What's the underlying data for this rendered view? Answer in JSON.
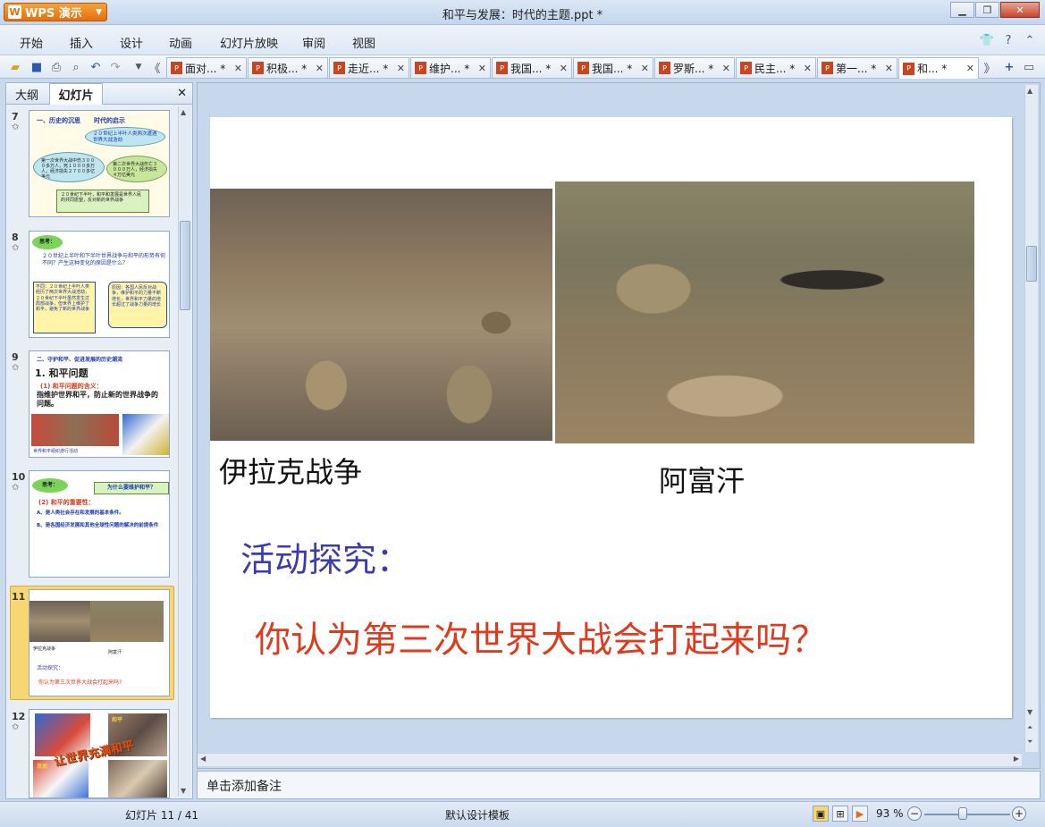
{
  "app": {
    "name": "WPS 演示",
    "window_title": "和平与发展：时代的主题.ppt *"
  },
  "menu": [
    "开始",
    "插入",
    "设计",
    "动画",
    "幻灯片放映",
    "审阅",
    "视图"
  ],
  "tabs": [
    {
      "label": "面对... *"
    },
    {
      "label": "积极... *"
    },
    {
      "label": "走近... *"
    },
    {
      "label": "维护... *"
    },
    {
      "label": "我国... *"
    },
    {
      "label": "我国... *"
    },
    {
      "label": "罗斯... *"
    },
    {
      "label": "民主... *"
    },
    {
      "label": "第一... *"
    },
    {
      "label": "和... *"
    }
  ],
  "left_panel": {
    "tab_outline": "大纲",
    "tab_slides": "幻灯片",
    "slides": [
      {
        "num": "7"
      },
      {
        "num": "8"
      },
      {
        "num": "9"
      },
      {
        "num": "10"
      },
      {
        "num": "11"
      },
      {
        "num": "12"
      }
    ],
    "thumb7": {
      "heading": "一、历史的沉思",
      "heading2": "时代的启示",
      "bubble1": "２０世纪上半叶人类两次遭遇世界大战浩劫",
      "bubble2": "第一次世界大战中伤３０００多万人，死１０００多万人，经济损失２７００多亿美元",
      "bubble3": "第二次世界大战伤亡３０００万人，经济损失４万亿美元",
      "box": "２０世纪下半叶，和平和发展是世界人民的共同愿望，反对新的世界战争"
    },
    "thumb8": {
      "think": "思考：",
      "question": "２０世纪上半叶和下半叶世界战争与和平的形势有何不同？产生这种变化的原因是什么？",
      "left_box": "不同：２０世纪上半叶人类经历了两次世界大战浩劫，２０世纪下半叶虽然发生过局部战争，但世界上维护了和平，避免了新的世界战争",
      "right_box": "原因：各国人民反对战争，维护和平的力量不断增长，世界和平力量的增长超过了战争力量的增长"
    },
    "thumb9": {
      "section": "二、守护和平、促进发展的历史潮流",
      "title": "1. 和平问题",
      "sub": "(1) 和平问题的含义：",
      "body": "指维护世界和平，防止新的世界战争的问题。",
      "caption": "世界和平组织游行活动"
    },
    "thumb10": {
      "think": "思考：",
      "question": "为什么要维护和平？",
      "sub": "(2) 和平的重要性：",
      "a": "A、是人类社会存在和发展的基本条件。",
      "b": "B、是各国经济发展和其他全球性问题的解决的前提条件"
    },
    "thumb11": {
      "cap1": "伊拉克战争",
      "cap2": "阿富汗",
      "activity": "活动探究：",
      "question": "你认为第三次世界大战会打起来吗?"
    },
    "thumb12": {
      "art": "让世界充满和平",
      "cap1": "和平",
      "cap2": "发展"
    }
  },
  "slide": {
    "caption_left": "伊拉克战争",
    "caption_right": "阿富汗",
    "activity_label": "活动探究：",
    "question": "你认为第三次世界大战会打起来吗？"
  },
  "notes_placeholder": "单击添加备注",
  "status": {
    "slide_counter": "幻灯片 11 / 41",
    "template": "默认设计模板",
    "zoom": "93 %"
  },
  "colors": {
    "activity_label": "#3a3bb0",
    "question": "#e03a1e",
    "accent_orange": "#e2700d"
  }
}
